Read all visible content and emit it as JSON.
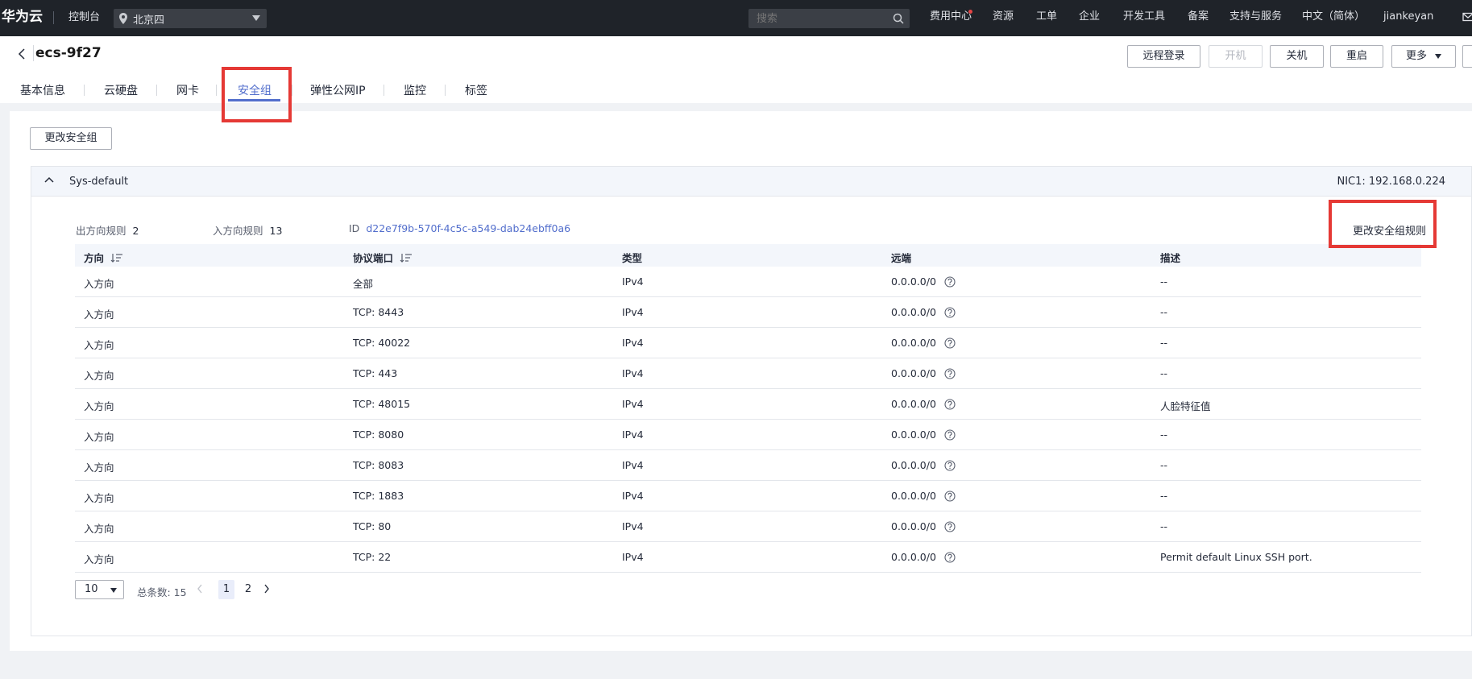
{
  "topbar": {
    "logo": "华为云",
    "console": "控制台",
    "region": "北京四",
    "search_placeholder": "搜索",
    "nav": [
      "费用中心",
      "资源",
      "工单",
      "企业",
      "开发工具",
      "备案",
      "支持与服务",
      "中文（简体）",
      "jiankeyan"
    ]
  },
  "header": {
    "title": "ecs-9f27",
    "buttons": {
      "remote_login": "远程登录",
      "power_on": "开机",
      "power_off": "关机",
      "restart": "重启",
      "more": "更多"
    }
  },
  "tabs": [
    "基本信息",
    "云硬盘",
    "网卡",
    "安全组",
    "弹性公网IP",
    "监控",
    "标签"
  ],
  "active_tab": "安全组",
  "actions": {
    "change_sg": "更改安全组"
  },
  "group": {
    "name": "Sys-default",
    "nic": "NIC1: 192.168.0.224",
    "outbound_label": "出方向规则",
    "outbound_count": "2",
    "inbound_label": "入方向规则",
    "inbound_count": "13",
    "id_label": "ID",
    "id_value": "d22e7f9b-570f-4c5c-a549-dab24ebff0a6",
    "edit_rules": "更改安全组规则"
  },
  "table": {
    "columns": [
      "方向",
      "协议端口",
      "类型",
      "远端",
      "描述"
    ],
    "rows": [
      [
        "入方向",
        "全部",
        "IPv4",
        "0.0.0.0/0",
        "--"
      ],
      [
        "入方向",
        "TCP: 8443",
        "IPv4",
        "0.0.0.0/0",
        "--"
      ],
      [
        "入方向",
        "TCP: 40022",
        "IPv4",
        "0.0.0.0/0",
        "--"
      ],
      [
        "入方向",
        "TCP: 443",
        "IPv4",
        "0.0.0.0/0",
        "--"
      ],
      [
        "入方向",
        "TCP: 48015",
        "IPv4",
        "0.0.0.0/0",
        "人脸特征值"
      ],
      [
        "入方向",
        "TCP: 8080",
        "IPv4",
        "0.0.0.0/0",
        "--"
      ],
      [
        "入方向",
        "TCP: 8083",
        "IPv4",
        "0.0.0.0/0",
        "--"
      ],
      [
        "入方向",
        "TCP: 1883",
        "IPv4",
        "0.0.0.0/0",
        "--"
      ],
      [
        "入方向",
        "TCP: 80",
        "IPv4",
        "0.0.0.0/0",
        "--"
      ],
      [
        "入方向",
        "TCP: 22",
        "IPv4",
        "0.0.0.0/0",
        "Permit default Linux SSH port."
      ]
    ]
  },
  "pagination": {
    "page_size": "10",
    "total_label": "总条数: 15",
    "pages": [
      "1",
      "2"
    ],
    "current_page": "1"
  },
  "colors": {
    "topbar_bg": "#1f2329",
    "accent": "#526ecc",
    "highlight": "#e53935"
  }
}
